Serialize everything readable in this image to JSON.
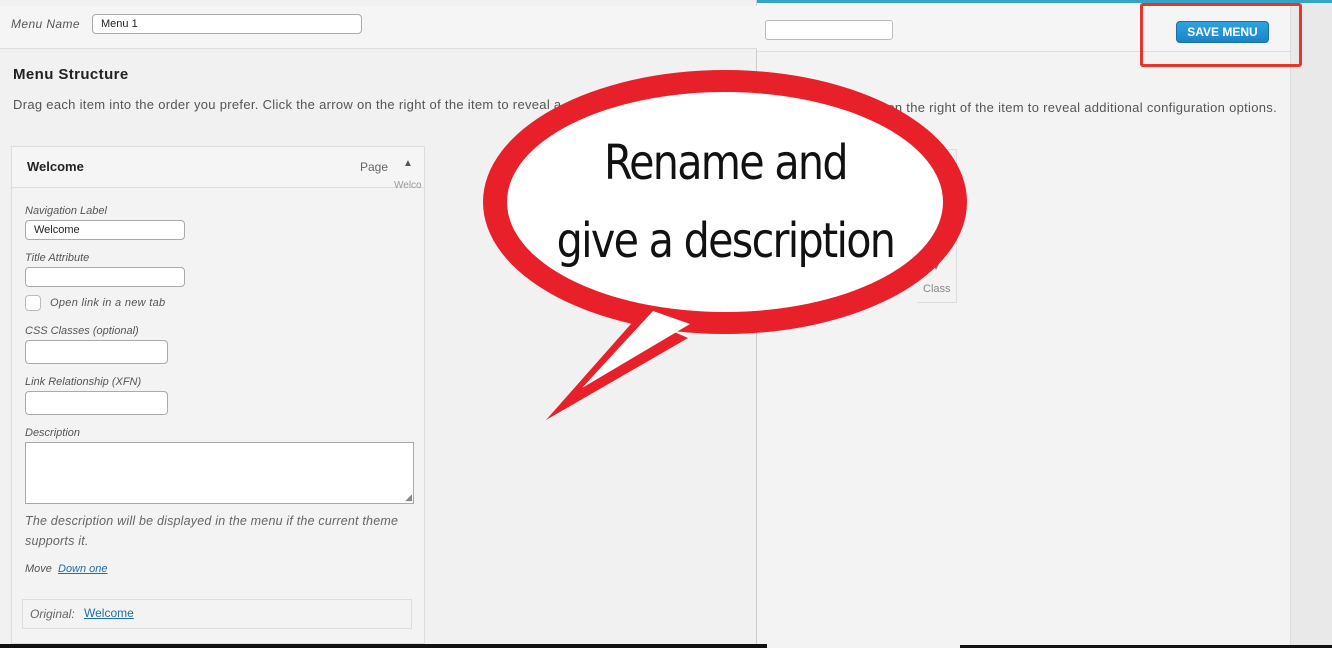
{
  "menu_name": {
    "label": "Menu Name",
    "value": "Menu 1"
  },
  "menu_structure": {
    "title": "Menu Structure",
    "instructions_left": "Drag each item into the order you prefer. Click the arrow on the right of the item to reveal a",
    "instructions_right": "on the right of the item to reveal additional configuration options."
  },
  "save_menu_label": "SAVE MENU",
  "menu_item": {
    "title": "Welcome",
    "type": "Page",
    "toggle_icon": "arrow-up-icon",
    "overflow_text": "Welco",
    "nav_label_label": "Navigation Label",
    "nav_label_value": "Welcome",
    "title_attr_label": "Title Attribute",
    "title_attr_value": "",
    "new_tab_label": "Open link in a new tab",
    "css_label": "CSS Classes (optional)",
    "xfn_label": "Link Relationship (XFN)",
    "description_label": "Description",
    "description_value": "",
    "description_help": "The description will be displayed in the menu if the current theme supports it.",
    "move_label": "Move",
    "move_down_link": "Down one",
    "original_label": "Original:",
    "original_link": "Welcome"
  },
  "right_item": {
    "arrow": "▼",
    "class_text": "Class"
  },
  "callout": {
    "line1": "Rename and",
    "line2": "give a description",
    "bubble_color": "#e8202a",
    "highlight_color": "#e8352a"
  },
  "colors": {
    "accent": "#2ea2e0",
    "link": "#1f6fa8"
  }
}
